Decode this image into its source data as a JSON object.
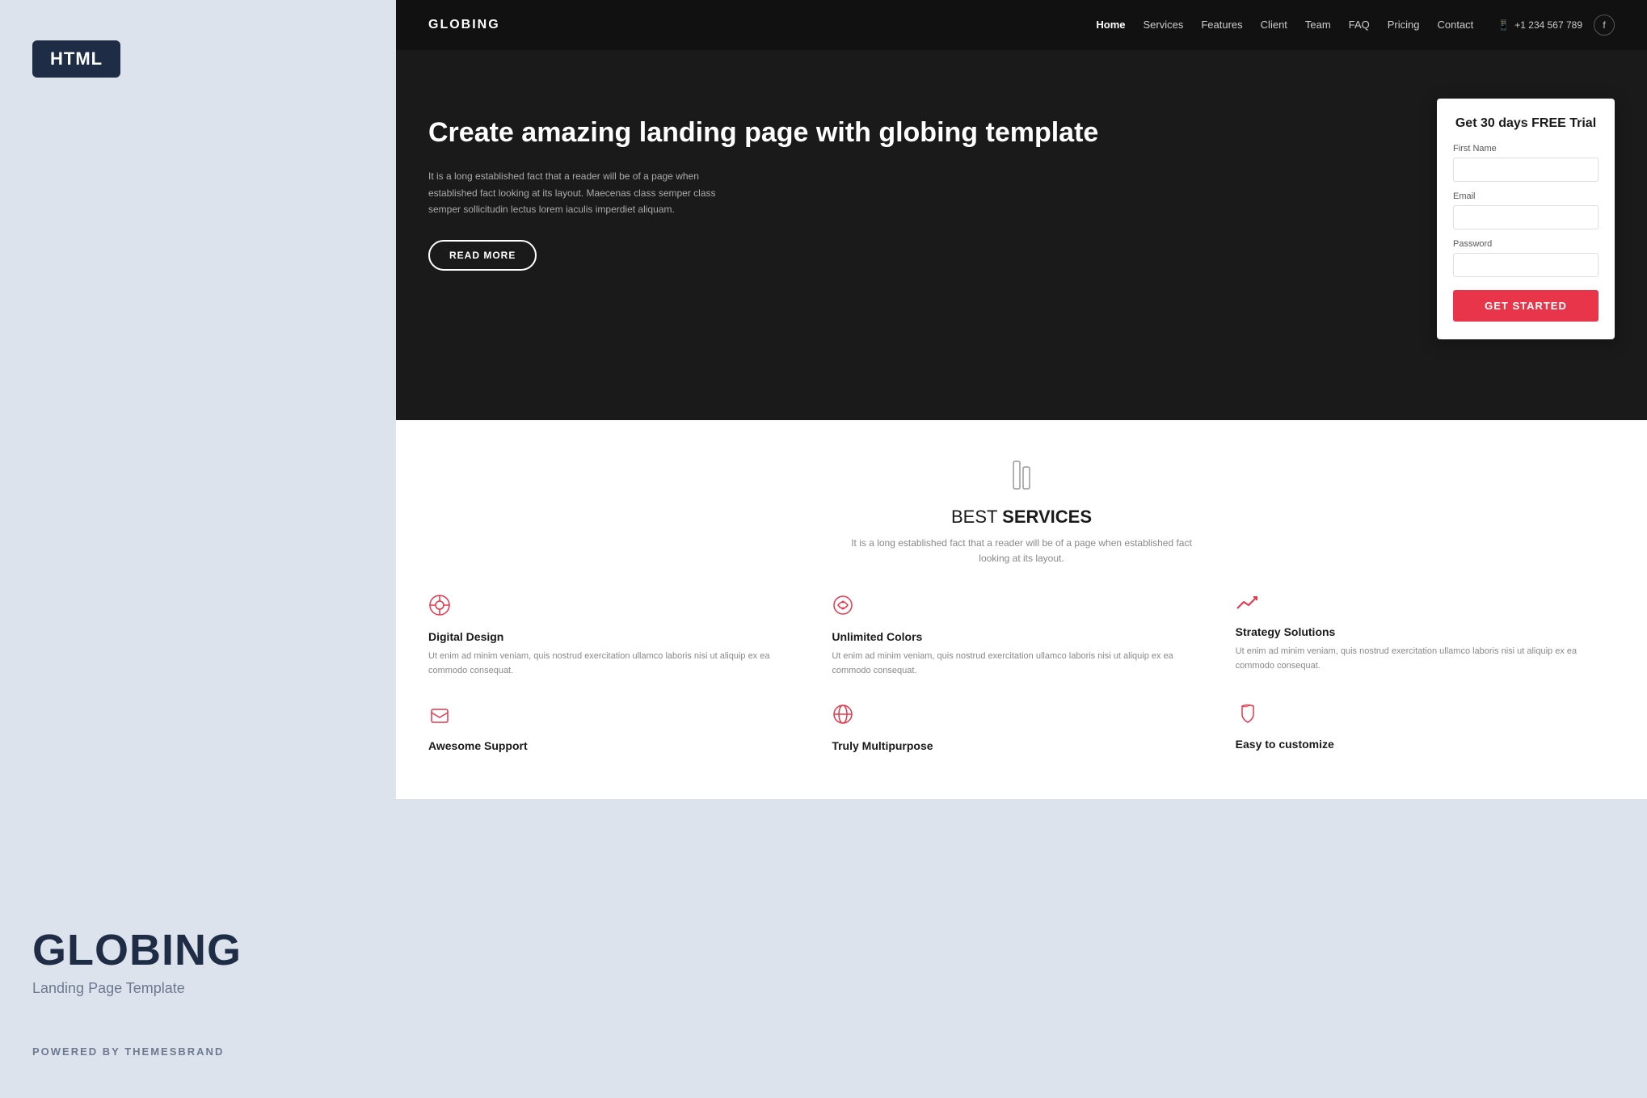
{
  "left_panel": {
    "badge": "HTML",
    "brand_name": "GLOBING",
    "subtitle": "Landing Page Template",
    "powered_by": "POWERED BY THEMESBRAND"
  },
  "navbar": {
    "logo": "GLOBING",
    "links": [
      {
        "label": "Home",
        "active": true
      },
      {
        "label": "Services"
      },
      {
        "label": "Features"
      },
      {
        "label": "Client"
      },
      {
        "label": "Team"
      },
      {
        "label": "FAQ"
      },
      {
        "label": "Pricing"
      },
      {
        "label": "Contact"
      }
    ],
    "phone": "+1 234 567 789",
    "phone_icon": "📱",
    "fb_icon": "f"
  },
  "hero": {
    "title": "Create amazing landing page with globing template",
    "description": "It is a long established fact that a reader will be of a page when established fact looking at its layout. Maecenas class semper class semper sollicitudin lectus lorem iaculis imperdiet aliquam.",
    "read_more_label": "READ MORE"
  },
  "trial_card": {
    "title": "Get 30 days FREE Trial",
    "first_name_label": "First Name",
    "email_label": "Email",
    "password_label": "Password",
    "button_label": "GET STARTED"
  },
  "services": {
    "section_icon": "✏",
    "heading_normal": "BEST ",
    "heading_bold": "SERVICES",
    "description": "It is a long established fact that a reader will be of a page when established fact\nlooking at its layout.",
    "items": [
      {
        "icon": "⚙",
        "title": "Digital Design",
        "text": "Ut enim ad minim veniam, quis nostrud exercitation ullamco laboris nisi ut aliquip ex ea commodo consequat."
      },
      {
        "icon": "🎨",
        "title": "Unlimited Colors",
        "text": "Ut enim ad minim veniam, quis nostrud exercitation ullamco laboris nisi ut aliquip ex ea commodo consequat."
      },
      {
        "icon": "📈",
        "title": "Strategy Solutions",
        "text": "Ut enim ad minim veniam, quis nostrud exercitation ullamco laboris nisi ut aliquip ex ea commodo consequat."
      },
      {
        "icon": "📦",
        "title": "Awesome Support",
        "text": ""
      },
      {
        "icon": "🌐",
        "title": "Truly Multipurpose",
        "text": ""
      },
      {
        "icon": "🎧",
        "title": "Easy to customize",
        "text": ""
      }
    ]
  }
}
